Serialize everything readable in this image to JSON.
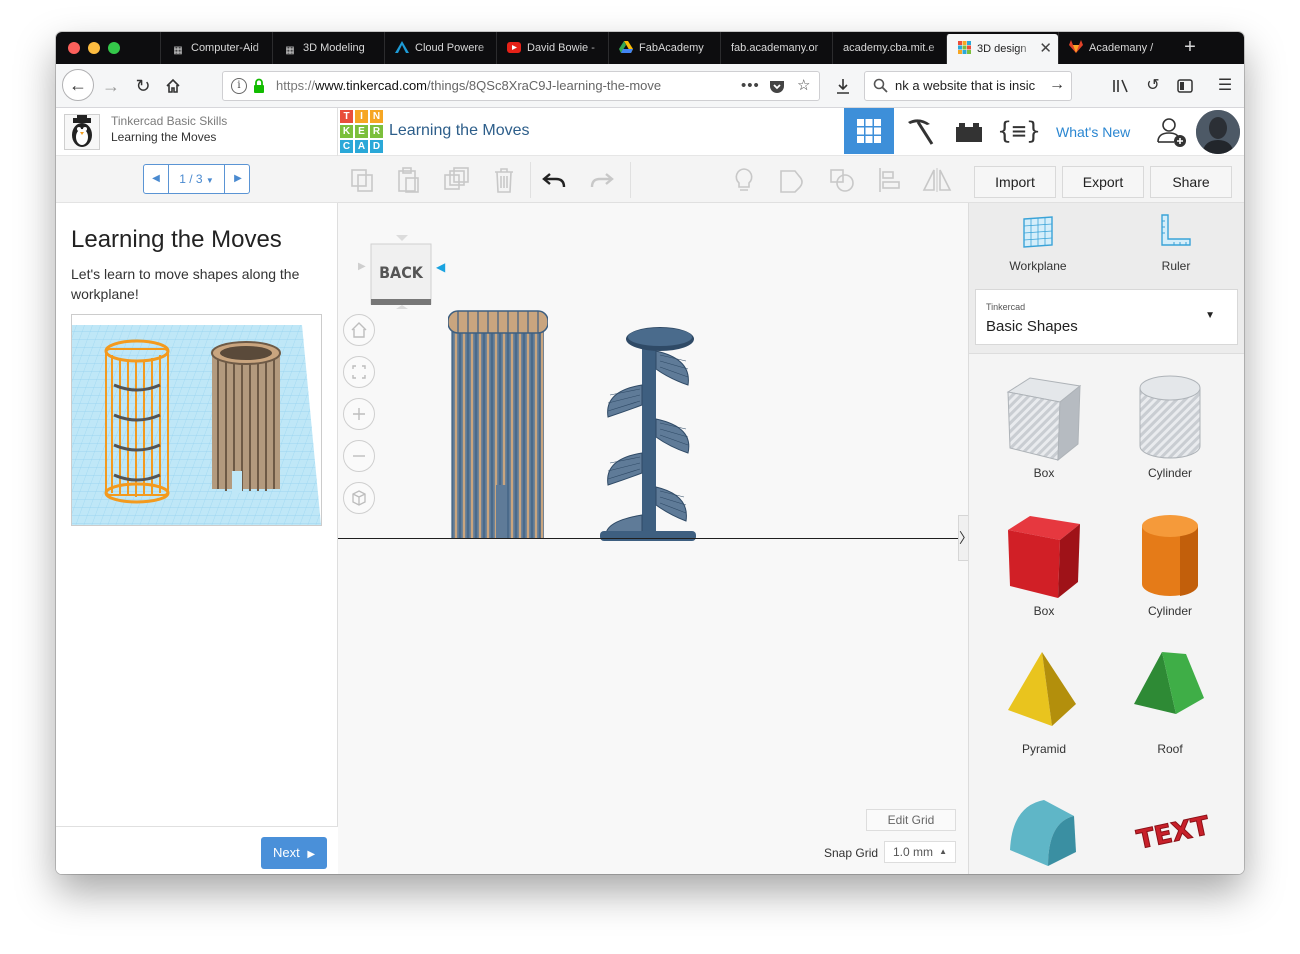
{
  "browser": {
    "tabs": [
      {
        "label": "Computer-Aid",
        "icon": "book-icon"
      },
      {
        "label": "3D Modeling",
        "icon": "book-icon"
      },
      {
        "label": "Cloud Powere",
        "icon": "autodesk-icon"
      },
      {
        "label": "David Bowie -",
        "icon": "youtube-icon"
      },
      {
        "label": "FabAcademy",
        "icon": "google-drive-icon"
      },
      {
        "label": "fab.academany.or",
        "icon": ""
      },
      {
        "label": "academy.cba.mit.e",
        "icon": ""
      },
      {
        "label": "3D design",
        "icon": "tinkercad-icon",
        "active": true
      },
      {
        "label": "Academany /",
        "icon": "gitlab-icon"
      }
    ],
    "url": {
      "scheme": "https://",
      "domain": "www.tinkercad.com",
      "path": "/things/8QSc8XraC9J-learning-the-move"
    },
    "search_text": "nk a website that is insic"
  },
  "header": {
    "course": "Tinkercad Basic Skills",
    "lesson": "Learning the Moves",
    "logo_letters": [
      "T",
      "I",
      "N",
      "K",
      "E",
      "R",
      "C",
      "A",
      "D"
    ],
    "design_title": "Learning the Moves",
    "whats_new": "What's New"
  },
  "lesson_panel": {
    "pager": "1 / 3",
    "title": "Learning the Moves",
    "description": "Let's learn to move shapes along the workplane!",
    "next": "Next"
  },
  "editor": {
    "viewcube_label": "BACK",
    "edit_grid": "Edit Grid",
    "snap_grid_label": "Snap Grid",
    "snap_grid_value": "1.0 mm"
  },
  "actions": {
    "import": "Import",
    "export": "Export",
    "share": "Share"
  },
  "right_panel": {
    "workplane": "Workplane",
    "ruler": "Ruler",
    "category": "Tinkercad",
    "library": "Basic Shapes",
    "shapes": [
      {
        "label": "Box",
        "icon": "box-hole-icon"
      },
      {
        "label": "Cylinder",
        "icon": "cylinder-hole-icon"
      },
      {
        "label": "Box",
        "icon": "box-red-icon"
      },
      {
        "label": "Cylinder",
        "icon": "cylinder-orange-icon"
      },
      {
        "label": "Pyramid",
        "icon": "pyramid-icon"
      },
      {
        "label": "Roof",
        "icon": "roof-icon"
      },
      {
        "label": "",
        "icon": "round-roof-icon"
      },
      {
        "label": "",
        "icon": "text-icon"
      }
    ]
  },
  "colors": {
    "accent": "#3d8fd9",
    "link": "#2a86d1",
    "object_blue": "#3e5f80",
    "stripe": "#c9a57f",
    "next": "#4a90d9"
  }
}
